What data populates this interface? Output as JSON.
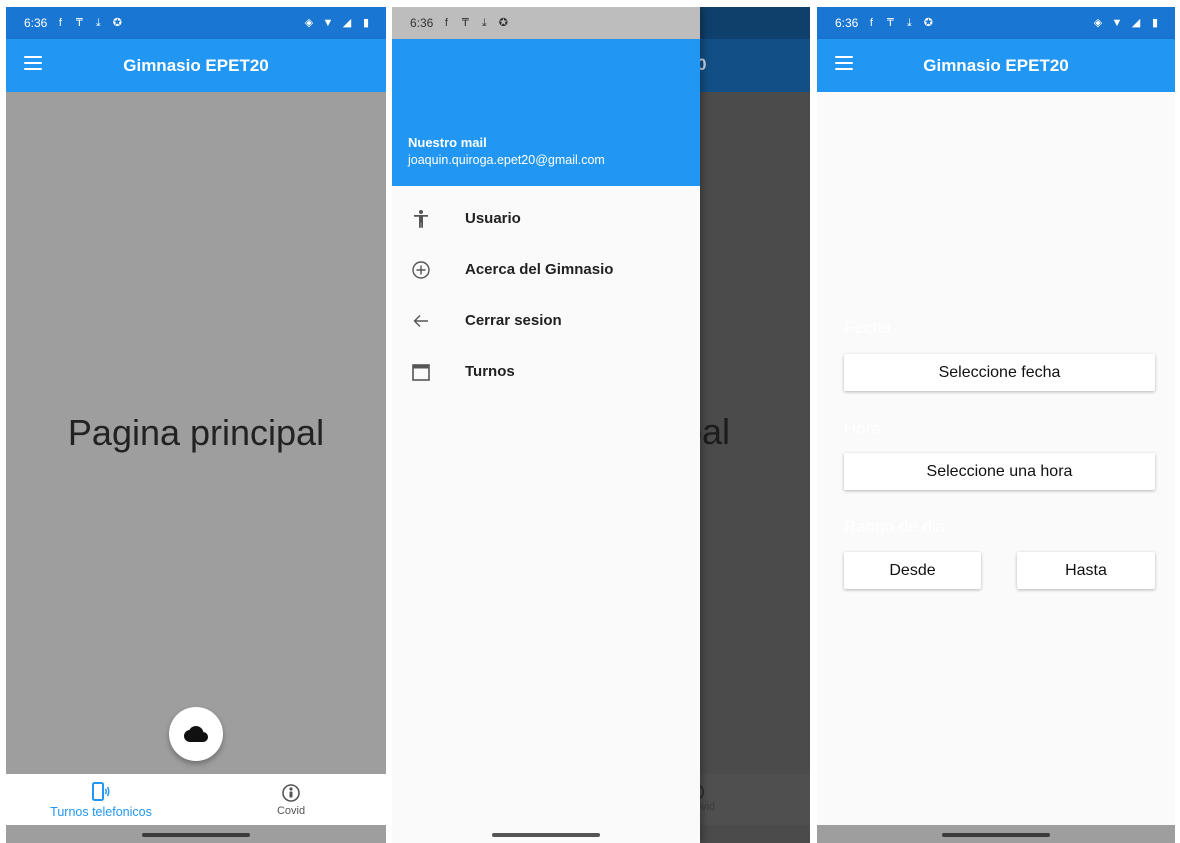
{
  "status": {
    "time": "6:36"
  },
  "screen_home": {
    "app_title": "Gimnasio EPET20",
    "main_text": "Pagina principal",
    "bottom_nav": [
      {
        "label": "Turnos telefonicos",
        "icon": "phone-call-icon",
        "active": true
      },
      {
        "label": "Covid",
        "icon": "person-circle-icon",
        "active": false
      }
    ],
    "fab_icon": "cloud-icon",
    "colors": {
      "primary": "#2196f3",
      "status": "#1976d2",
      "content_bg": "#9e9e9e"
    }
  },
  "screen_drawer": {
    "header_label": "Nuestro mail",
    "header_email": "joaquin.quiroga.epet20@gmail.com",
    "items": [
      {
        "label": "Usuario",
        "icon": "accessibility-icon"
      },
      {
        "label": "Acerca del Gimnasio",
        "icon": "add-circle-icon"
      },
      {
        "label": "Cerrar sesion",
        "icon": "arrow-back-icon"
      },
      {
        "label": "Turnos",
        "icon": "calendar-icon"
      }
    ],
    "peek_title": "0",
    "peek_text": "pal",
    "peek_covid": "ovid"
  },
  "screen_form": {
    "app_title": "Gimnasio EPET20",
    "fecha_label": "Fecha",
    "fecha_button": "Seleccione fecha",
    "hora_label": "Hora",
    "hora_button": "Seleccione una hora",
    "rango_label": "Rango de dia",
    "desde_button": "Desde",
    "hasta_button": "Hasta",
    "range_arrow": "→"
  }
}
